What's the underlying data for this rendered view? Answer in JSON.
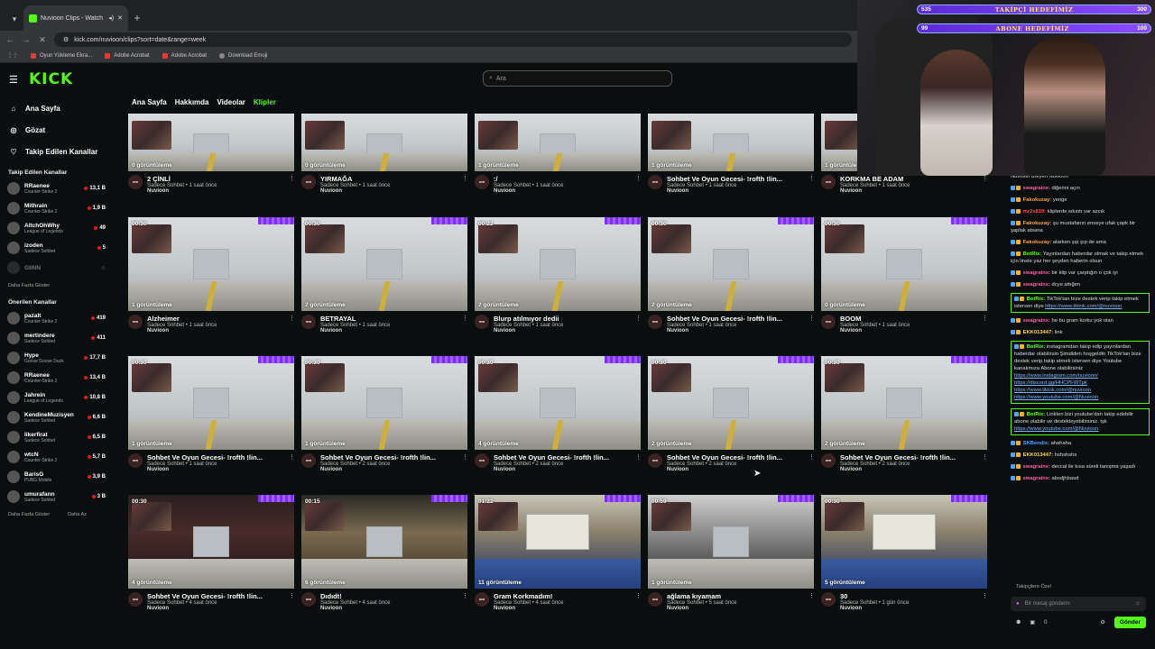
{
  "browser": {
    "tab_title": "Nuvioon Clips - Watch Live",
    "url": "kick.com/nuvioon/clips?sort=date&range=week",
    "bookmarks": [
      "Oyun Yükleme Ekra...",
      "Adobe Acrobat",
      "Adobe Acrobat",
      "Download Emoji"
    ]
  },
  "header": {
    "logo": "KICK",
    "search_placeholder": "Ara"
  },
  "sidebar": {
    "main": [
      "Ana Sayfa",
      "Gözat",
      "Takip Edilen Kanallar"
    ],
    "followed_title": "Takip Edilen Kanallar",
    "followed": [
      {
        "name": "RRaenee",
        "game": "Counter-Strike 2",
        "viewers": "13,1 B"
      },
      {
        "name": "Mithrain",
        "game": "Counter-Strike 2",
        "viewers": "1,9 B"
      },
      {
        "name": "AltchOhWhy",
        "game": "League of Legends",
        "viewers": "49"
      },
      {
        "name": "izoden",
        "game": "Sadece Sohbet",
        "viewers": "5"
      },
      {
        "name": "GIINN",
        "game": "",
        "viewers": ""
      }
    ],
    "show_more": "Daha Fazla Göster",
    "recommended_title": "Önerilen Kanallar",
    "recommended": [
      {
        "name": "pazalt",
        "game": "Counter-Strike 2",
        "viewers": "419"
      },
      {
        "name": "mertindere",
        "game": "Sadece Sohbet",
        "viewers": "411"
      },
      {
        "name": "Hype",
        "game": "Goose Goose Duck",
        "viewers": "17,7 B"
      },
      {
        "name": "RRaenee",
        "game": "Counter-Strike 2",
        "viewers": "13,4 B"
      },
      {
        "name": "Jahrein",
        "game": "League of Legends",
        "viewers": "10,8 B"
      },
      {
        "name": "KendineMuzisyen",
        "game": "Sadece Sohbet",
        "viewers": "6,6 B"
      },
      {
        "name": "likerfirat",
        "game": "Sadece Sohbet",
        "viewers": "6,5 B"
      },
      {
        "name": "wtcN",
        "game": "Counter-Strike 2",
        "viewers": "5,7 B"
      },
      {
        "name": "BarisG",
        "game": "PUBG Mobile",
        "viewers": "3,9 B"
      },
      {
        "name": "umurafann",
        "game": "Sadece Sohbet",
        "viewers": "3 B"
      }
    ],
    "show_more2": "Daha Fazla Göster",
    "show_less": "Daha Az"
  },
  "page_tabs": [
    "Ana Sayfa",
    "Hakkımda",
    "Videolar",
    "Klipler"
  ],
  "clips": [
    {
      "dur": "",
      "views": "0 görüntüleme",
      "title": "2 ÇİNLİ",
      "cat": "Sadece Sohbet",
      "ago": "1 saat önce",
      "ch": "Nuvioon",
      "kind": "hall"
    },
    {
      "dur": "",
      "views": "0 görüntüleme",
      "title": "YIRMAĞA",
      "cat": "Sadece Sohbet",
      "ago": "1 saat önce",
      "ch": "Nuvioon",
      "kind": "hall"
    },
    {
      "dur": "",
      "views": "1 görüntüleme",
      "title": ":/",
      "cat": "Sadece Sohbet",
      "ago": "1 saat önce",
      "ch": "Nuvioon",
      "kind": "hall"
    },
    {
      "dur": "",
      "views": "1 görüntüleme",
      "title": "Sohbet Ve Oyun Gecesi- !rofth !lin...",
      "cat": "Sadece Sohbet",
      "ago": "1 saat önce",
      "ch": "Nuvioon",
      "kind": "hall"
    },
    {
      "dur": "",
      "views": "1 görüntüleme",
      "title": "KORKMA BE ADAM",
      "cat": "Sadece Sohbet",
      "ago": "1 saat önce",
      "ch": "Nuvioon",
      "kind": "hall"
    },
    {
      "dur": "00:30",
      "views": "1 görüntüleme",
      "title": "Alzheimer",
      "cat": "Sadece Sohbet",
      "ago": "1 saat önce",
      "ch": "Nuvioon",
      "kind": "hall"
    },
    {
      "dur": "00:30",
      "views": "2 görüntüleme",
      "title": "BETRAYAL",
      "cat": "Sadece Sohbet",
      "ago": "1 saat önce",
      "ch": "Nuvioon",
      "kind": "hall"
    },
    {
      "dur": "00:22",
      "views": "2 görüntüleme",
      "title": "Blurp atılmıyor dedii",
      "cat": "Sadece Sohbet",
      "ago": "1 saat önce",
      "ch": "Nuvioon",
      "kind": "hall"
    },
    {
      "dur": "00:30",
      "views": "2 görüntüleme",
      "title": "Sohbet Ve Oyun Gecesi- !rofth !lin...",
      "cat": "Sadece Sohbet",
      "ago": "1 saat önce",
      "ch": "Nuvioon",
      "kind": "hall"
    },
    {
      "dur": "00:30",
      "views": "0 görüntüleme",
      "title": "BOOM",
      "cat": "Sadece Sohbet",
      "ago": "1 saat önce",
      "ch": "Nuvioon",
      "kind": "hall"
    },
    {
      "dur": "00:30",
      "views": "1 görüntüleme",
      "title": "Sohbet Ve Oyun Gecesi- !rofth !lin...",
      "cat": "Sadece Sohbet",
      "ago": "1 saat önce",
      "ch": "Nuvioon",
      "kind": "hall"
    },
    {
      "dur": "00:30",
      "views": "1 görüntüleme",
      "title": "Sohbet Ve Oyun Gecesi- !rofth !lin...",
      "cat": "Sadece Sohbet",
      "ago": "2 saat önce",
      "ch": "Nuvioon",
      "kind": "hall"
    },
    {
      "dur": "00:30",
      "views": "4 görüntüleme",
      "title": "Sohbet Ve Oyun Gecesi- !rofth !lin...",
      "cat": "Sadece Sohbet",
      "ago": "2 saat önce",
      "ch": "Nuvioon",
      "kind": "hall"
    },
    {
      "dur": "00:30",
      "views": "2 görüntüleme",
      "title": "Sohbet Ve Oyun Gecesi- !rofth !lin...",
      "cat": "Sadece Sohbet",
      "ago": "2 saat önce",
      "ch": "Nuvioon",
      "kind": "hall"
    },
    {
      "dur": "00:30",
      "views": "2 görüntüleme",
      "title": "Sohbet Ve Oyun Gecesi- !rofth !lin...",
      "cat": "Sadece Sohbet",
      "ago": "2 saat önce",
      "ch": "Nuvioon",
      "kind": "hall"
    },
    {
      "dur": "00:30",
      "views": "4 görüntüleme",
      "title": "Sohbet Ve Oyun Gecesi- !rofth !lin...",
      "cat": "Sadece Sohbet",
      "ago": "4 saat önce",
      "ch": "Nuvioon",
      "kind": "dark"
    },
    {
      "dur": "00:15",
      "views": "6 görüntüleme",
      "title": "Dıdıdt!",
      "cat": "Sadece Sohbet",
      "ago": "4 saat önce",
      "ch": "Nuvioon",
      "kind": "cart"
    },
    {
      "dur": "01:22",
      "views": "11 görüntüleme",
      "title": "Gram Korkmadım!",
      "cat": "Sadece Sohbet",
      "ago": "4 saat önce",
      "ch": "Nuvioon",
      "kind": "train"
    },
    {
      "dur": "00:59",
      "views": "1 görüntüleme",
      "title": "ağlama kıyamam",
      "cat": "Sadece Sohbet",
      "ago": "5 saat önce",
      "ch": "Nuvioon",
      "kind": "bw"
    },
    {
      "dur": "00:30",
      "views": "5 görüntüleme",
      "title": "30",
      "cat": "Sadece Sohbet",
      "ago": "1 gün önce",
      "ch": "Nuvioon",
      "kind": "train"
    }
  ],
  "overlay": {
    "goal1": {
      "left": "535",
      "label": "TAKİPÇİ HEDEFİMİZ",
      "right": "300"
    },
    "goal2": {
      "left": "99",
      "label": "ABONE HEDEFİMİZ",
      "right": "100"
    }
  },
  "chat": {
    "messages": [
      {
        "user": "",
        "text": "Nuvioon izleyen Nuvioon",
        "links": []
      },
      {
        "user": "swagrainx:",
        "text": "diğerini açın",
        "links": [],
        "color": "#ff5ca8"
      },
      {
        "user": "Fakokuzay:",
        "text": "yenge",
        "links": [],
        "color": "#ff9f40"
      },
      {
        "user": "mr2x819:",
        "text": "kliplerde sıkıntı var azcık",
        "links": [],
        "color": "#ff4d4d"
      },
      {
        "user": "Fakokuzay:",
        "text": "şu mustafanın enseye ufak çapk bir şaplak atsana",
        "links": [],
        "color": "#ff9f40"
      },
      {
        "user": "Fakokuzay:",
        "text": "atarken şıp şıp de ama",
        "links": [],
        "color": "#ff9f40"
      },
      {
        "user": "BotRix:",
        "text": "Yayınlardan haberdar olmak ve takip etmek için linste yaz her şeyden haberin olsun",
        "links": [],
        "color": "#53fc18"
      },
      {
        "user": "swagrainx:",
        "text": "bir klip var çarptığın o çok iyi",
        "links": [],
        "color": "#ff5ca8"
      },
      {
        "user": "swagrainx:",
        "text": "dcye attığım",
        "links": [],
        "color": "#ff5ca8"
      },
      {
        "user": "BotRix:",
        "text": "TikTok'tan bize destek verip takip etmek istersen diye",
        "links": [
          "https://www.tiktok.com/@nuvioon"
        ],
        "color": "#53fc18",
        "box": true
      },
      {
        "user": "swagrainx:",
        "text": "he bu gram korku yok olan",
        "links": [],
        "color": "#ff5ca8"
      },
      {
        "user": "EKK013447:",
        "text": "link",
        "links": [],
        "color": "#ffd24d"
      },
      {
        "user": "BotRix:",
        "text": "instagramdan takip edip yayınlardan haberdar olabilirsin  Şimdiden hoşgeldin  TikTok'tan bize destek verip takip etmek istersen diye  Youtube kanalımıza Abone olabilirsiniz",
        "links": [
          "https://www.instagram.com/nuvioon/",
          "https://discord.gg/HHCPFWTpk",
          "https://www.tiktok.com/@nuvioon",
          "https://www.youtube.com/@Nuvioon"
        ],
        "color": "#53fc18",
        "box": true
      },
      {
        "user": "BotRix:",
        "text": "Linkten bizi youtube'dan takip edebilir abone olabilir ve destekleyebilirsiniz. tşk",
        "links": [
          "https://www.youtube.com/@Nuvioon"
        ],
        "color": "#53fc18",
        "box": true
      },
      {
        "user": "SKBendix:",
        "text": "ahahaha",
        "links": [],
        "color": "#4da6ff"
      },
      {
        "user": "EKK013447:",
        "text": "hshshshs",
        "links": [],
        "color": "#ffd24d"
      },
      {
        "user": "swagrainx:",
        "text": "deccal ile kısa süreli tanışma yaşadı",
        "links": [],
        "color": "#ff5ca8"
      },
      {
        "user": "swagrainx:",
        "text": "absdjhbasd",
        "links": [],
        "color": "#ff5ca8"
      }
    ],
    "followers_only": "Takipçilere Özel",
    "input_placeholder": "Bir mesaj gönderin",
    "send": "Gönder",
    "counter": "0"
  }
}
